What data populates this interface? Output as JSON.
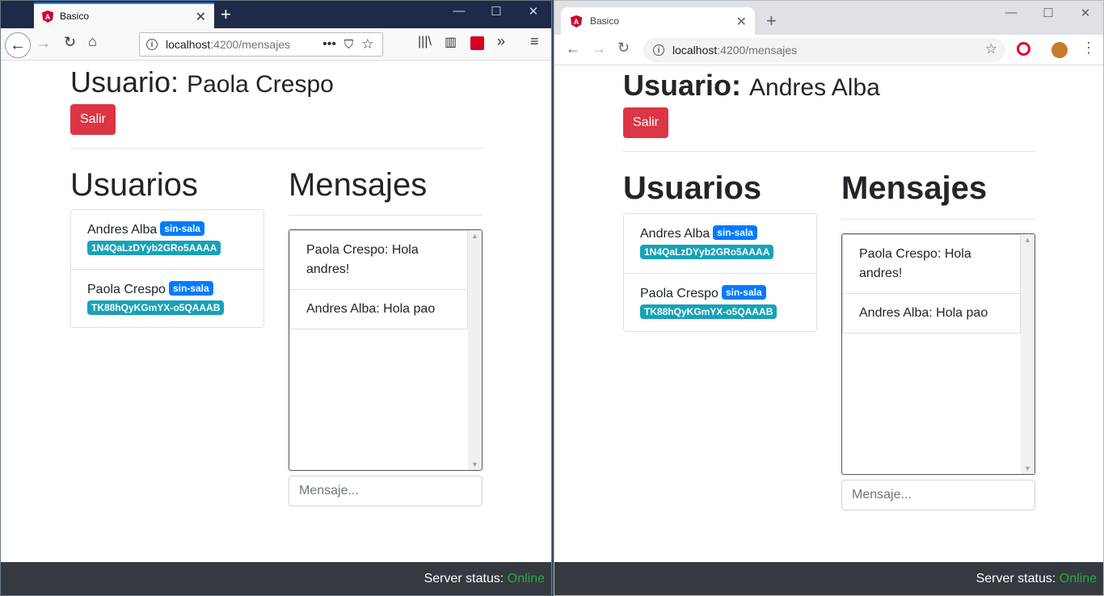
{
  "browsers": [
    {
      "tab_title": "Basico",
      "url_host": "localhost",
      "url_path": ":4200/mensajes",
      "user_label": "Usuario:",
      "user_name": "Paola Crespo",
      "logout_label": "Salir",
      "users_heading": "Usuarios",
      "messages_heading": "Mensajes",
      "users": [
        {
          "name": "Andres Alba",
          "room": "sin-sala",
          "id": "1N4QaLzDYyb2GRo5AAAA"
        },
        {
          "name": "Paola Crespo",
          "room": "sin-sala",
          "id": "TK88hQyKGmYX-o5QAAAB"
        }
      ],
      "messages": [
        "Paola Crespo: Hola andres!",
        "Andres Alba: Hola pao"
      ],
      "message_placeholder": "Mensaje...",
      "server_status_label": "Server status:",
      "server_status_value": "Online"
    },
    {
      "tab_title": "Basico",
      "url_host": "localhost",
      "url_path": ":4200/mensajes",
      "user_label": "Usuario:",
      "user_name": "Andres Alba",
      "logout_label": "Salir",
      "users_heading": "Usuarios",
      "messages_heading": "Mensajes",
      "users": [
        {
          "name": "Andres Alba",
          "room": "sin-sala",
          "id": "1N4QaLzDYyb2GRo5AAAA"
        },
        {
          "name": "Paola Crespo",
          "room": "sin-sala",
          "id": "TK88hQyKGmYX-o5QAAAB"
        }
      ],
      "messages": [
        "Paola Crespo: Hola andres!",
        "Andres Alba: Hola pao"
      ],
      "message_placeholder": "Mensaje...",
      "server_status_label": "Server status:",
      "server_status_value": "Online"
    }
  ],
  "colors": {
    "danger": "#dc3545",
    "primary": "#007bff",
    "info": "#17a2b8",
    "footer": "#343a40",
    "online": "#28a745"
  }
}
